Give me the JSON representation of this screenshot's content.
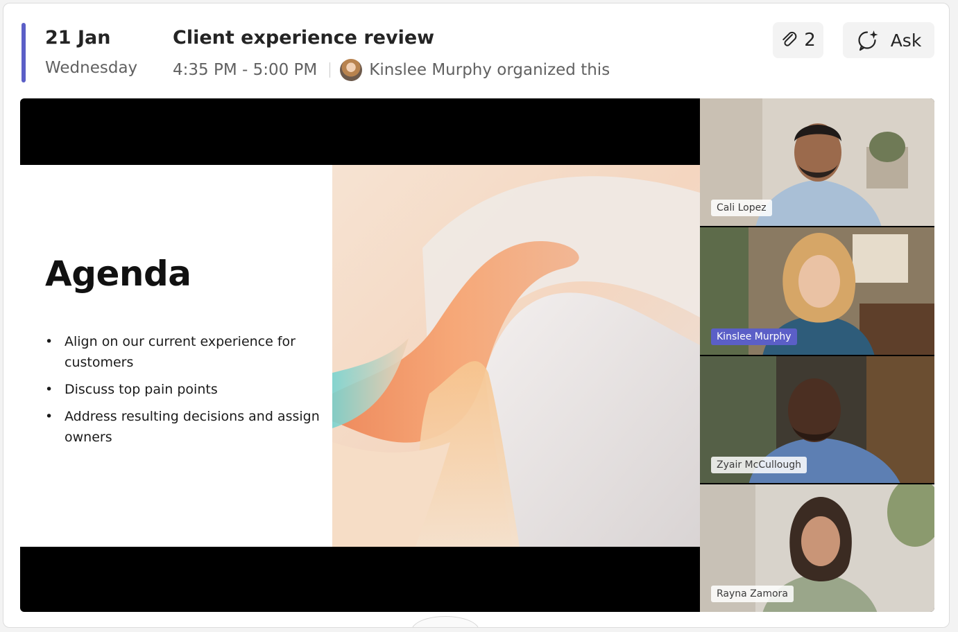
{
  "header": {
    "date": "21 Jan",
    "weekday": "Wednesday",
    "title": "Client experience review",
    "time": "4:35 PM - 5:00 PM",
    "organizer_text": "Kinslee Murphy organized this",
    "accent_color": "#5b5fc7"
  },
  "actions": {
    "attachments_count": "2",
    "attachments_icon": "paperclip-icon",
    "ask_label": "Ask",
    "ask_icon": "copilot-sparkle-icon"
  },
  "slide": {
    "heading": "Agenda",
    "bullets": [
      "Align on our current experience for customers",
      "Discuss top pain points",
      "Address resulting decisions and assign owners"
    ]
  },
  "participants": [
    {
      "name": "Cali Lopez",
      "speaking": false
    },
    {
      "name": "Kinslee Murphy",
      "speaking": true
    },
    {
      "name": "Zyair McCullough",
      "speaking": false
    },
    {
      "name": "Rayna Zamora",
      "speaking": false
    }
  ]
}
